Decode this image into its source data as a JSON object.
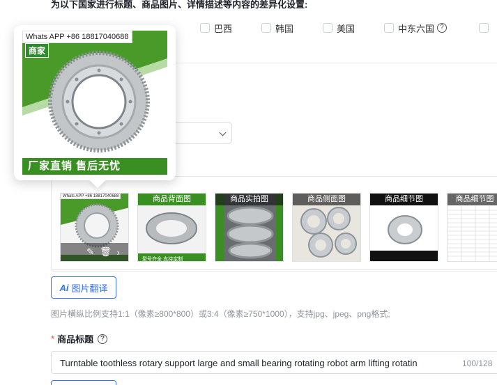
{
  "section": {
    "heading": "为以下国家进行标题、商品图片、详情描述等内容的差异化设置:",
    "countries": [
      {
        "label": "巴西"
      },
      {
        "label": "韩国"
      },
      {
        "label": "美国"
      },
      {
        "label": "中东六国"
      }
    ],
    "help_icon": "help-circle-icon"
  },
  "preview": {
    "watermark": "Whats APP +86 18817040688",
    "brand_tag": "商家",
    "banner": "厂家直销 售后无忧"
  },
  "images": {
    "thumbnails": [
      {
        "caption": "",
        "tools": [
          "edit-icon",
          "delete-icon",
          "next-icon"
        ]
      },
      {
        "caption": "商品背面图"
      },
      {
        "caption": "商品实拍图"
      },
      {
        "caption": "商品侧面图"
      },
      {
        "caption": "商品细节图"
      },
      {
        "caption": "商品细节图"
      }
    ],
    "translate_button": {
      "ai_badge": "Ai",
      "label": "图片翻译"
    },
    "hint": "图片横纵比例支持1:1（像素≥800*800）或3:4（像素≥750*1000），支持jpg、jpeg、png格式;"
  },
  "title_field": {
    "required_mark": "*",
    "label": "商品标题",
    "value": "Turntable toothless rotary support large and small bearing rotating robot arm lifting rotatin",
    "counter": "100/128"
  },
  "colors": {
    "accent": "#3370ff",
    "required": "#f54a45",
    "brand_green": "#3a8f22"
  }
}
